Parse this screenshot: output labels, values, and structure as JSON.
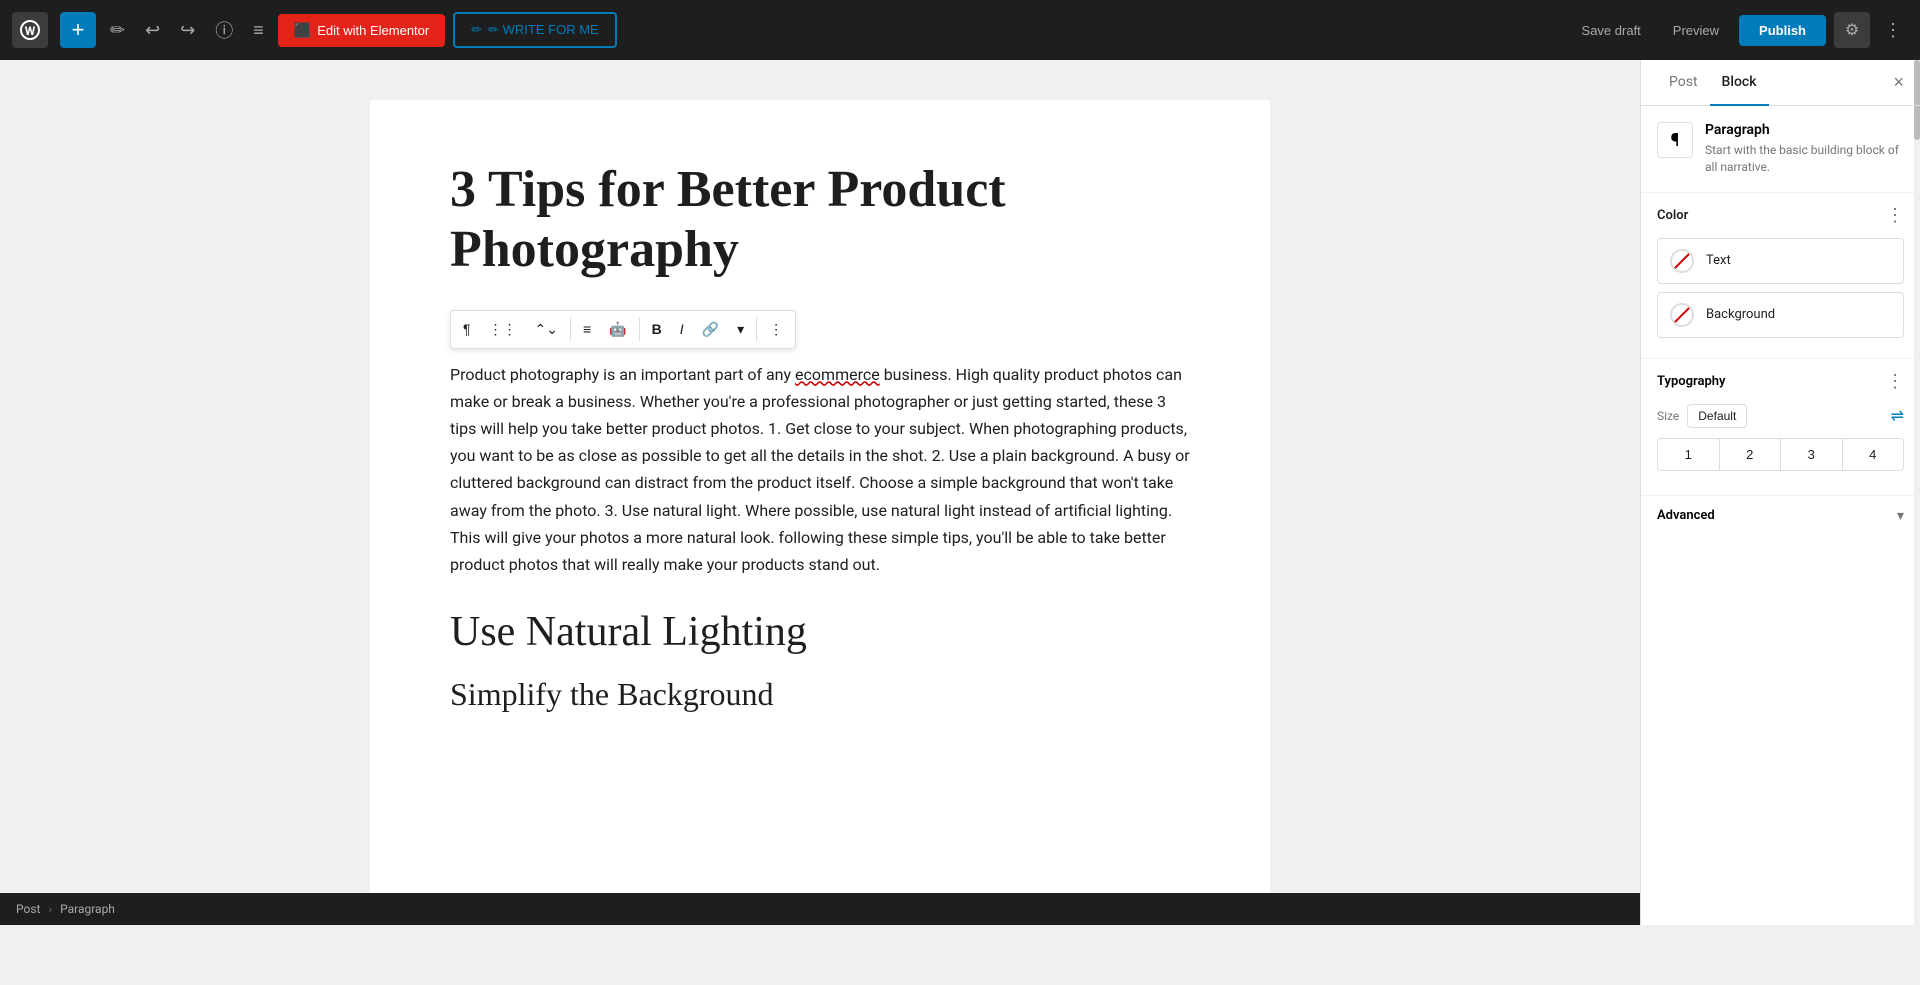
{
  "toolbar": {
    "add_label": "+",
    "edit_elementor_label": "Edit with Elementor",
    "write_for_me_label": "✏ WRITE FOR ME",
    "save_draft_label": "Save draft",
    "preview_label": "Preview",
    "publish_label": "Publish"
  },
  "block_toolbar": {
    "paragraph_icon": "¶",
    "drag_icon": "⋮⋮",
    "move_icon": "⌃⌄",
    "align_icon": "≡",
    "avatar_icon": "🤖",
    "bold_label": "B",
    "italic_label": "I",
    "link_icon": "🔗",
    "dropdown_icon": "▾",
    "more_icon": "⋮"
  },
  "post": {
    "title": "3 Tips for Better Product Photography",
    "body": "Product photography is an important part of any ecommerce business. High quality product photos can make or break a business. Whether you're a professional photographer or just getting started, these 3 tips will help you take better product photos. 1. Get close to your subject. When photographing products, you want to be as close as possible to get all the details in the shot. 2. Use a plain background. A busy or cluttered background can distract from the product itself. Choose a simple background that won't take away from the photo. 3. Use natural light. Where possible, use natural light instead of artificial lighting. This will give your photos a more natural look.  following these simple tips, you'll be able to take better product photos that will really make your products stand out.",
    "section_heading": "Use Natural Lighting",
    "section_subheading": "Simplify the Background"
  },
  "sidebar": {
    "post_tab": "Post",
    "block_tab": "Block",
    "close_label": "×",
    "block_name": "Paragraph",
    "block_desc": "Start with the basic building block of all narrative.",
    "color_section_title": "Color",
    "text_label": "Text",
    "background_label": "Background",
    "typography_section_title": "Typography",
    "size_label": "Size",
    "size_default": "Default",
    "font_sizes": [
      "1",
      "2",
      "3",
      "4"
    ],
    "advanced_label": "Advanced",
    "advanced_chevron": "▾"
  },
  "breadcrumb": {
    "post_label": "Post",
    "separator": "›",
    "paragraph_label": "Paragraph"
  },
  "icons": {
    "plus": "+",
    "pencil": "✏",
    "undo": "↩",
    "redo": "↪",
    "info": "ⓘ",
    "list": "≡",
    "gear": "⚙",
    "ellipsis": "⋮",
    "slider": "⇌",
    "chevron_down": "▾"
  }
}
